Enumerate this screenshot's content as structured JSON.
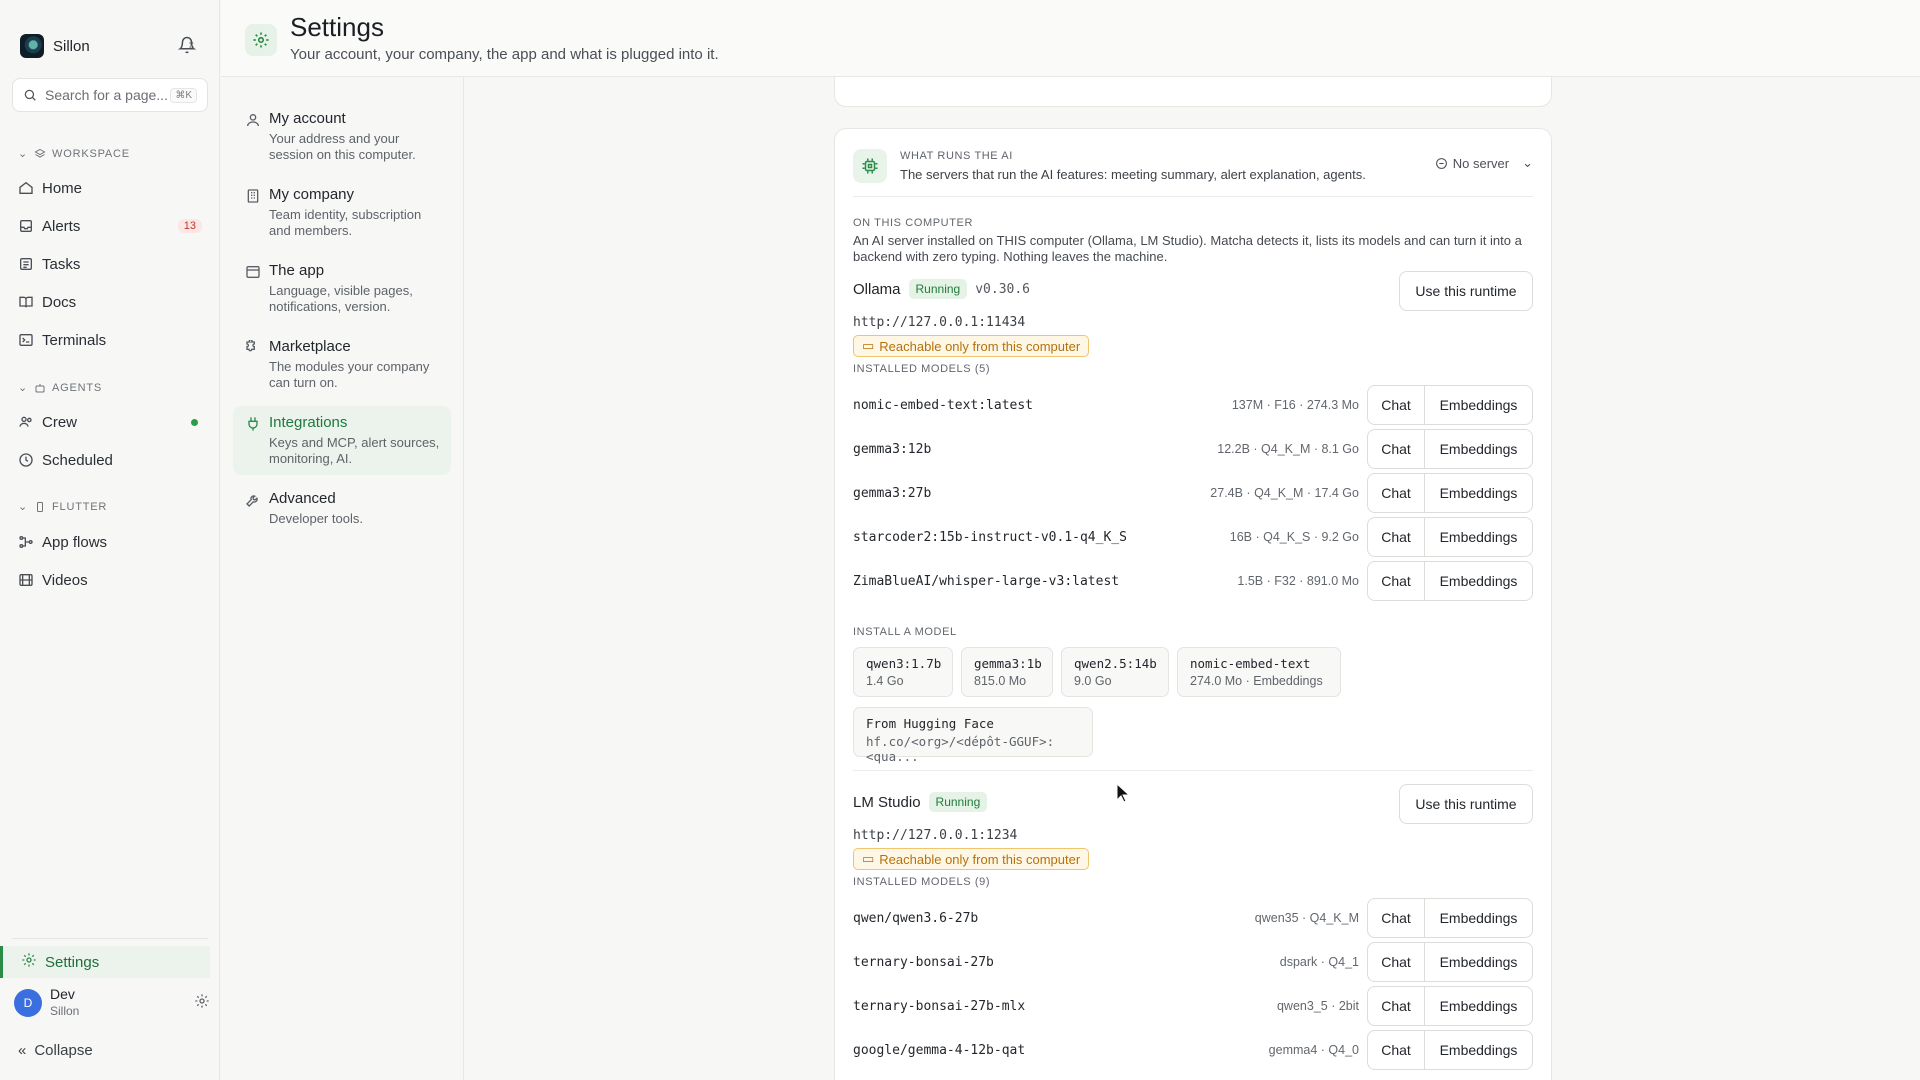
{
  "workspace": {
    "name": "Sillon"
  },
  "search": {
    "placeholder": "Search for a page...",
    "shortcut": "⌘K"
  },
  "sidebar": {
    "workspace_header": "WORKSPACE",
    "agents_header": "AGENTS",
    "flutter_header": "FLUTTER",
    "items": {
      "home": "Home",
      "alerts": "Alerts",
      "alerts_count": "13",
      "tasks": "Tasks",
      "docs": "Docs",
      "terminals": "Terminals",
      "crew": "Crew",
      "scheduled": "Scheduled",
      "app_flows": "App flows",
      "videos": "Videos"
    },
    "settings": "Settings",
    "user": {
      "initial": "D",
      "name": "Dev",
      "org": "Sillon"
    },
    "collapse": "Collapse"
  },
  "header": {
    "title": "Settings",
    "subtitle": "Your account, your company, the app and what is plugged into it."
  },
  "subnav": [
    {
      "title": "My account",
      "desc": "Your address and your session on this computer."
    },
    {
      "title": "My company",
      "desc": "Team identity, subscription and members."
    },
    {
      "title": "The app",
      "desc": "Language, visible pages, notifications, version."
    },
    {
      "title": "Marketplace",
      "desc": "The modules your company can turn on."
    },
    {
      "title": "Integrations",
      "desc": "Keys and MCP, alert sources, monitoring, AI."
    },
    {
      "title": "Advanced",
      "desc": "Developer tools."
    }
  ],
  "ai_card": {
    "kicker": "WHAT RUNS THE AI",
    "desc": "The servers that run the AI features: meeting summary, alert explanation, agents.",
    "status": "No server",
    "local_label": "ON THIS COMPUTER",
    "local_desc": "An AI server installed on THIS computer (Ollama, LM Studio). Matcha detects it, lists its models and can turn it into a backend with zero typing. Nothing leaves the machine.",
    "use_runtime": "Use this runtime",
    "chat_label": "Chat",
    "embeddings_label": "Embeddings",
    "reachable": "Reachable only from this computer",
    "runtimes": [
      {
        "name": "Ollama",
        "status": "Running",
        "version": "v0.30.6",
        "url": "http://127.0.0.1:11434",
        "models_label": "INSTALLED MODELS (5)",
        "models": [
          {
            "name": "nomic-embed-text:latest",
            "meta": "137M · F16 · 274.3 Mo"
          },
          {
            "name": "gemma3:12b",
            "meta": "12.2B · Q4_K_M · 8.1 Go"
          },
          {
            "name": "gemma3:27b",
            "meta": "27.4B · Q4_K_M · 17.4 Go"
          },
          {
            "name": "starcoder2:15b-instruct-v0.1-q4_K_S",
            "meta": "16B · Q4_K_S · 9.2 Go"
          },
          {
            "name": "ZimaBlueAI/whisper-large-v3:latest",
            "meta": "1.5B · F32 · 891.0 Mo"
          }
        ],
        "install_label": "INSTALL A MODEL",
        "install_options": [
          {
            "name": "qwen3:1.7b",
            "size": "1.4 Go"
          },
          {
            "name": "gemma3:1b",
            "size": "815.0 Mo"
          },
          {
            "name": "qwen2.5:14b",
            "size": "9.0 Go"
          },
          {
            "name": "nomic-embed-text",
            "size": "274.0 Mo · Embeddings"
          }
        ],
        "hf": {
          "name": "From Hugging Face",
          "hint": "hf.co/<org>/<dépôt-GGUF>:<qua..."
        }
      },
      {
        "name": "LM Studio",
        "status": "Running",
        "url": "http://127.0.0.1:1234",
        "models_label": "INSTALLED MODELS (9)",
        "models": [
          {
            "name": "qwen/qwen3.6-27b",
            "meta": "qwen35 · Q4_K_M"
          },
          {
            "name": "ternary-bonsai-27b",
            "meta": "dspark · Q4_1"
          },
          {
            "name": "ternary-bonsai-27b-mlx",
            "meta": "qwen3_5 · 2bit"
          },
          {
            "name": "google/gemma-4-12b-qat",
            "meta": "gemma4 · Q4_0"
          }
        ]
      }
    ]
  },
  "colors": {
    "accent": "#2a8c47",
    "warning": "#b4720c",
    "alert": "#c4372f"
  }
}
